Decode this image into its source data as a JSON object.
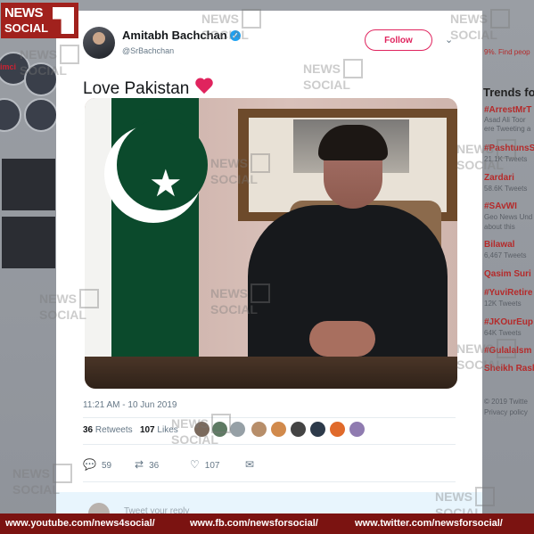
{
  "logo": {
    "line1": "NEWS",
    "line2": "SOCIAL"
  },
  "watermark": {
    "line1": "NEWS",
    "line2": "SOCIAL"
  },
  "background_left": {
    "mini_label": "imci"
  },
  "background_right": {
    "find_text": "9%. Find peop",
    "trends_title": "Trends fo",
    "items": [
      {
        "tag": "#ArrestMrT",
        "sub": "Asad Ali Toor"
      },
      {
        "tag": "",
        "sub": "ere Tweeting a"
      },
      {
        "tag": "#PashtunsS",
        "sub": "21.1K Tweets"
      },
      {
        "tag": "Zardari",
        "sub": "58.6K Tweets"
      },
      {
        "tag": "#SAvWI",
        "sub": "Geo News Und"
      },
      {
        "tag": "",
        "sub": "about this"
      },
      {
        "tag": "Bilawal",
        "sub": "6,467 Tweets"
      },
      {
        "tag": "Qasim Suri",
        "sub": ""
      },
      {
        "tag": "#YuviRetire",
        "sub": "12K Tweets"
      },
      {
        "tag": "#JKOurEup",
        "sub": "64K Tweets"
      },
      {
        "tag": "#Gulalalsm",
        "sub": ""
      },
      {
        "tag": "Sheikh Rash",
        "sub": ""
      },
      {
        "tag": "",
        "sub": "© 2019 Twitte"
      },
      {
        "tag": "",
        "sub": "Privacy policy"
      }
    ]
  },
  "tweet": {
    "author_name": "Amitabh Bachchan",
    "author_handle": "@SrBachchan",
    "follow_label": "Follow",
    "text": "Love Pakistan",
    "timestamp": "11:21 AM - 10 Jun 2019",
    "retweets_count": "36",
    "retweets_label": "Retweets",
    "likes_count": "107",
    "likes_label": "Likes",
    "reply_count": "59",
    "retweet_action_count": "36",
    "like_action_count": "107",
    "reply_placeholder": "Tweet your reply"
  },
  "banner": {
    "youtube": "www.youtube.com/news4social/",
    "facebook": "www.fb.com/newsforsocial/",
    "twitter": "www.twitter.com/newsforsocial/"
  },
  "colors": {
    "follow": "#e0245e",
    "verified": "#1da1f2",
    "banner": "#7b1311",
    "heart": "#e0245e"
  },
  "icons": [
    "verified-badge-icon",
    "chevron-down-icon",
    "heart-emoji-icon",
    "reply-icon",
    "retweet-icon",
    "like-icon",
    "direct-message-icon"
  ]
}
